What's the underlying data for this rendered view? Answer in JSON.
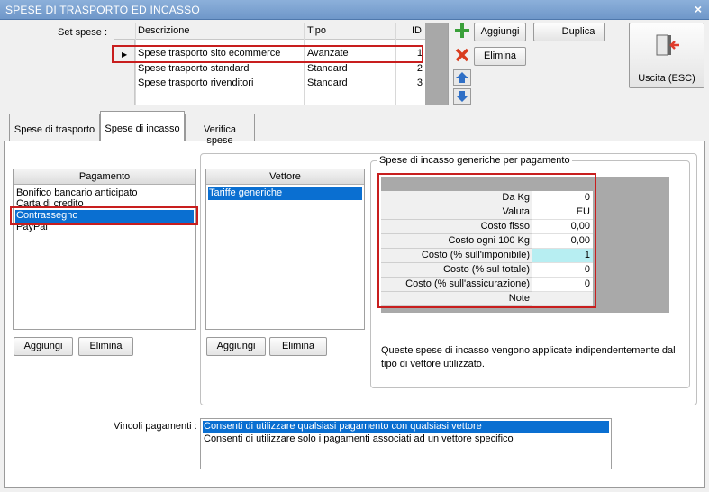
{
  "window": {
    "title": "SPESE DI TRASPORTO ED INCASSO",
    "close": "×"
  },
  "set_spese": {
    "label": "Set spese :",
    "columns": [
      "Descrizione",
      "Tipo",
      "ID"
    ],
    "current_marker": "▶",
    "rows": [
      {
        "descrizione": "Spese trasporto sito ecommerce",
        "tipo": "Avanzate",
        "id": "1"
      },
      {
        "descrizione": "Spese trasporto standard",
        "tipo": "Standard",
        "id": "2"
      },
      {
        "descrizione": "Spese trasporto rivenditori",
        "tipo": "Standard",
        "id": "3"
      }
    ]
  },
  "toolbar": {
    "aggiungi": "Aggiungi",
    "duplica": "Duplica",
    "elimina": "Elimina",
    "uscita": "Uscita (ESC)"
  },
  "tabs": [
    "Spese di trasporto",
    "Spese di incasso",
    "Verifica spese"
  ],
  "pagamento": {
    "header": "Pagamento",
    "items": [
      "Bonifico bancario anticipato",
      "Carta di credito",
      "Contrassegno",
      "PayPal"
    ],
    "add": "Aggiungi",
    "remove": "Elimina"
  },
  "vettore": {
    "header": "Vettore",
    "items": [
      "Tariffe generiche"
    ],
    "add": "Aggiungi",
    "remove": "Elimina"
  },
  "incasso": {
    "group_title": "Spese di incasso generiche per pagamento",
    "props": [
      {
        "name": "Da Kg",
        "value": "0"
      },
      {
        "name": "Valuta",
        "value": "EU"
      },
      {
        "name": "Costo fisso",
        "value": "0,00"
      },
      {
        "name": "Costo ogni 100 Kg",
        "value": "0,00"
      },
      {
        "name": "Costo (% sull'imponibile)",
        "value": "1"
      },
      {
        "name": "Costo (% sul totale)",
        "value": "0"
      },
      {
        "name": "Costo (% sull'assicurazione)",
        "value": "0"
      },
      {
        "name": "Note",
        "value": ""
      }
    ],
    "note": "Queste spese di incasso vengono applicate indipendentemente dal tipo di vettore utilizzato."
  },
  "vincoli": {
    "label": "Vincoli pagamenti :",
    "options": [
      "Consenti di utilizzare qualsiasi pagamento con qualsiasi vettore",
      "Consenti di utilizzare solo i pagamenti associati ad un vettore specifico"
    ]
  },
  "colors": {
    "selection": "#0a6fd1",
    "highlight_box": "#c81e1e",
    "title_bar": "#7aa0d0",
    "edited_cell": "#b7eef2"
  }
}
